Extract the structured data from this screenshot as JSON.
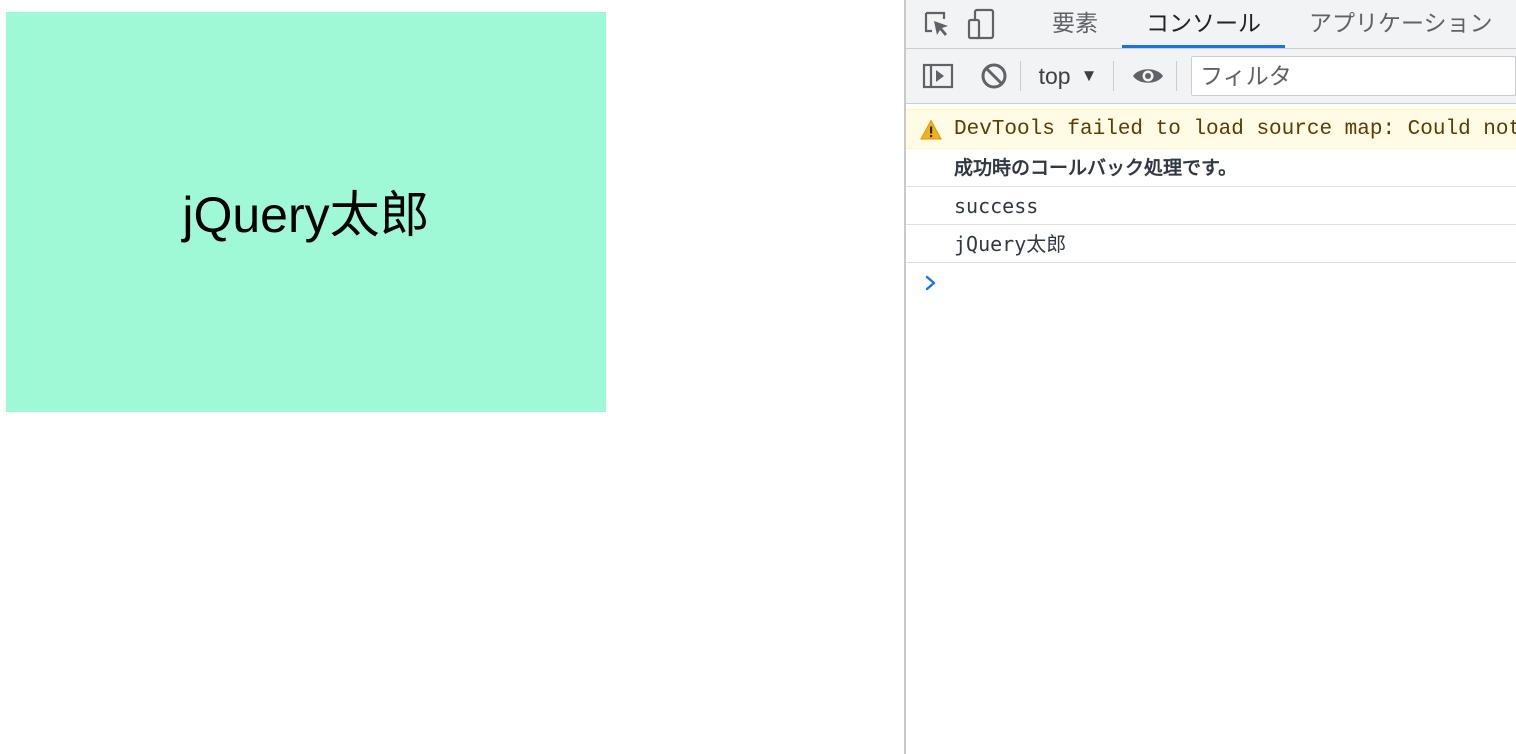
{
  "page": {
    "box_text": "jQuery太郎",
    "box_color": "#a0f9d6"
  },
  "devtools": {
    "tabs": [
      {
        "label": "要素",
        "active": false
      },
      {
        "label": "コンソール",
        "active": true
      },
      {
        "label": "アプリケーション",
        "active": false
      }
    ],
    "toolbar": {
      "context": "top",
      "filter_placeholder": "フィルタ"
    },
    "console": {
      "messages": [
        {
          "level": "warning",
          "text": "DevTools failed to load source map: Could not load content"
        },
        {
          "level": "log",
          "text": "成功時のコールバック処理です。"
        },
        {
          "level": "log",
          "text": "success"
        },
        {
          "level": "log",
          "text": "jQuery太郎"
        }
      ]
    },
    "colors": {
      "accent": "#1a73e8",
      "toolbar_bg": "#f1f3f4",
      "warning_bg": "#fffbe5",
      "warning_text": "#5c3c00"
    },
    "icons": [
      "element-picker-icon",
      "device-toggle-icon",
      "sidebar-toggle-icon",
      "clear-console-icon",
      "eye-icon",
      "warning-icon",
      "prompt-chevron-icon"
    ]
  }
}
